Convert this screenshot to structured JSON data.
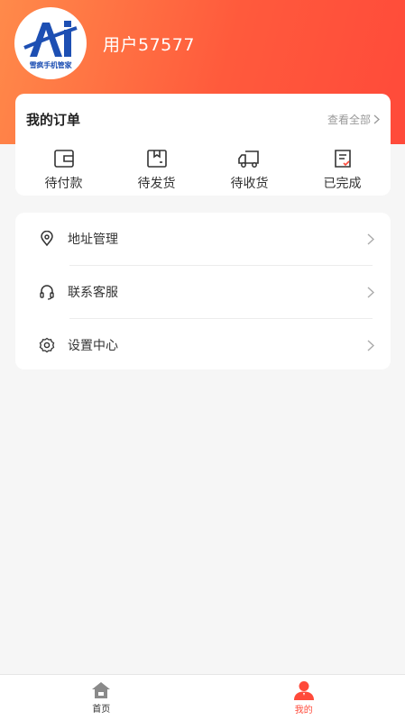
{
  "profile": {
    "username": "用户57577",
    "logo_text": "Ai",
    "logo_caption": "雪疯手机管家"
  },
  "orders": {
    "title": "我的订单",
    "view_all": "查看全部",
    "items": [
      {
        "label": "待付款",
        "icon": "wallet-icon"
      },
      {
        "label": "待发货",
        "icon": "package-icon"
      },
      {
        "label": "待收货",
        "icon": "truck-icon"
      },
      {
        "label": "已完成",
        "icon": "completed-doc-icon"
      }
    ]
  },
  "menu": {
    "items": [
      {
        "label": "地址管理",
        "icon": "location-pin-icon"
      },
      {
        "label": "联系客服",
        "icon": "headset-icon"
      },
      {
        "label": "设置中心",
        "icon": "gear-icon"
      }
    ]
  },
  "tabbar": {
    "items": [
      {
        "label": "首页",
        "icon": "home-icon",
        "active": false
      },
      {
        "label": "我的",
        "icon": "user-icon",
        "active": true
      }
    ]
  },
  "colors": {
    "header_start": "#ff8a4a",
    "header_end": "#ff4a3a",
    "accent": "#ff4a3a",
    "logo_blue": "#1d4fb3"
  }
}
